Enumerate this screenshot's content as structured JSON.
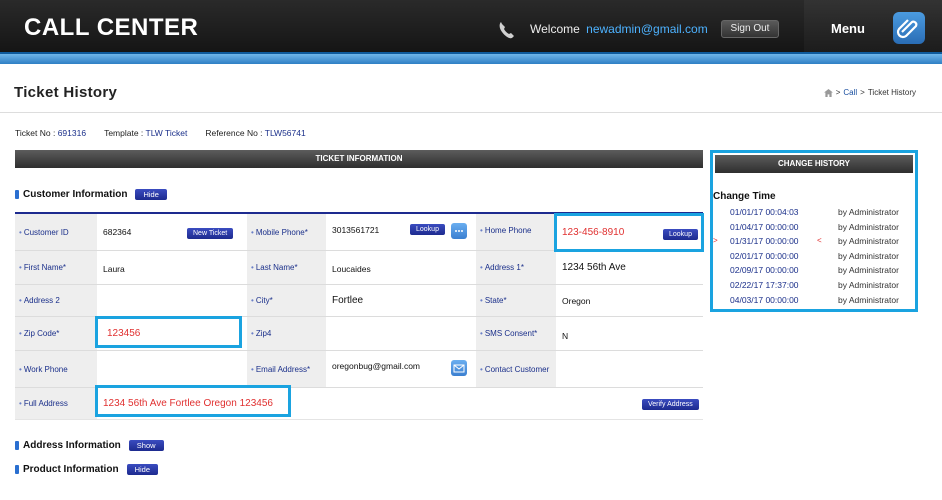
{
  "header": {
    "brand": "CALL CENTER",
    "welcome_text": "Welcome",
    "user_email": "newadmin@gmail.com",
    "signout_label": "Sign Out",
    "menu_label": "Menu"
  },
  "page": {
    "title": "Ticket History",
    "breadcrumb": {
      "sep1": ">",
      "link": "Call",
      "sep2": ">",
      "current": "Ticket History"
    }
  },
  "meta": {
    "ticket_label": "Ticket No :",
    "ticket_no": "691316",
    "template_label": "Template :",
    "template": "TLW Ticket",
    "reference_label": "Reference No :",
    "reference": "TLW56741"
  },
  "sections": {
    "ticket_info": "TICKET INFORMATION",
    "change_history": "CHANGE HISTORY",
    "customer": {
      "title": "Customer Information",
      "toggle": "Hide"
    },
    "address": {
      "title": "Address Information",
      "toggle": "Show"
    },
    "product": {
      "title": "Product Information",
      "toggle": "Hide"
    }
  },
  "customer": {
    "customer_id_label": "Customer ID",
    "customer_id": "682364",
    "new_ticket_label": "New Ticket",
    "mobile_label": "Mobile Phone*",
    "mobile": "3013561721",
    "lookup1_label": "Lookup",
    "home_phone_label": "Home Phone",
    "home_phone": "123-456-8910",
    "lookup2_label": "Lookup",
    "first_name_label": "First Name*",
    "first_name": "Laura",
    "last_name_label": "Last Name*",
    "last_name": "Loucaides",
    "address1_label": "Address 1*",
    "address1": "1234 56th Ave",
    "address2_label": "Address 2",
    "address2": "",
    "city_label": "City*",
    "city": "Fortlee",
    "state_label": "State*",
    "state": "Oregon",
    "zip_label": "Zip Code*",
    "zip": "123456",
    "zip4_label": "Zip4",
    "zip4": "",
    "sms_label": "SMS Consent*",
    "sms": "N",
    "work_phone_label": "Work Phone",
    "work_phone": "",
    "email_label": "Email Address*",
    "email": "oregonbug@gmail.com",
    "contact_label": "Contact Customer",
    "contact": "",
    "full_address_label": "Full Address",
    "full_address": "1234 56th Ave Fortlee Oregon 123456",
    "verify_label": "Verify Address"
  },
  "history": {
    "title": "Change Time",
    "entries": [
      {
        "time": "01/01/17 00:04:03",
        "by": "by Administrator"
      },
      {
        "time": "01/04/17 00:00:00",
        "by": "by Administrator"
      },
      {
        "time": "01/31/17 00:00:00",
        "by": "by Administrator",
        "marker_left": ">",
        "marker_right": "<"
      },
      {
        "time": "02/01/17 00:00:00",
        "by": "by Administrator"
      },
      {
        "time": "02/09/17 00:00:00",
        "by": "by Administrator"
      },
      {
        "time": "02/22/17 17:37:00",
        "by": "by Administrator"
      },
      {
        "time": "04/03/17 00:00:00",
        "by": "by Administrator"
      }
    ]
  },
  "colors": {
    "highlight": "#1aa3e0",
    "accent_blue": "#1d2a8f",
    "red_value": "#e03030"
  },
  "icons": [
    "phone-icon",
    "menu-logo-icon",
    "home-icon",
    "chat-icon",
    "mail-icon"
  ]
}
